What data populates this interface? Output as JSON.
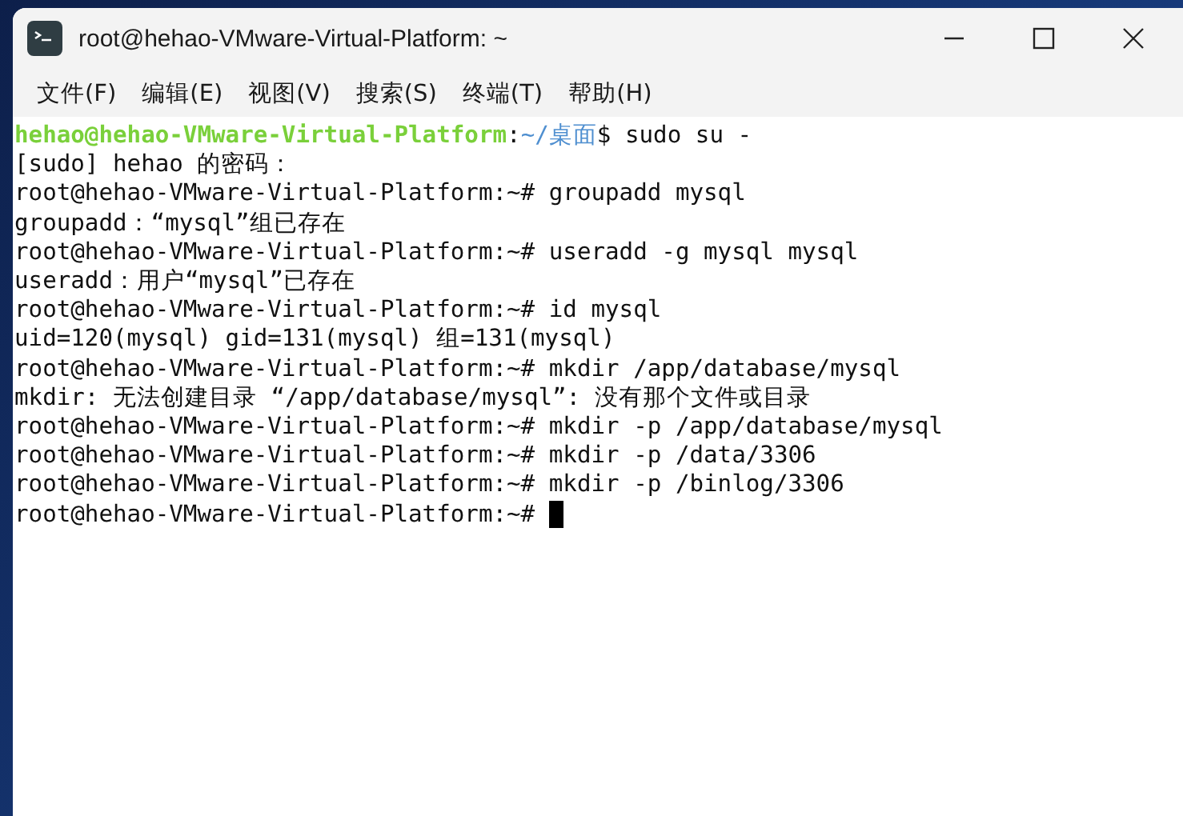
{
  "window": {
    "title": "root@hehao-VMware-Virtual-Platform: ~"
  },
  "menu": [
    "文件(F)",
    "编辑(E)",
    "视图(V)",
    "搜索(S)",
    "终端(T)",
    "帮助(H)"
  ],
  "terminal": {
    "lines": [
      {
        "segments": [
          {
            "kind": "user",
            "text": "hehao@hehao-VMware-Virtual-Platform"
          },
          {
            "kind": "plain",
            "text": ":"
          },
          {
            "kind": "path",
            "text": "~/桌面"
          },
          {
            "kind": "plain",
            "text": "$ sudo su -"
          }
        ]
      },
      {
        "segments": [
          {
            "kind": "plain",
            "text": "[sudo] hehao 的密码："
          }
        ]
      },
      {
        "segments": [
          {
            "kind": "plain",
            "text": "root@hehao-VMware-Virtual-Platform:~# groupadd mysql"
          }
        ]
      },
      {
        "segments": [
          {
            "kind": "plain",
            "text": "groupadd：“mysql”组已存在"
          }
        ]
      },
      {
        "segments": [
          {
            "kind": "plain",
            "text": "root@hehao-VMware-Virtual-Platform:~# useradd -g mysql mysql"
          }
        ]
      },
      {
        "segments": [
          {
            "kind": "plain",
            "text": "useradd：用户“mysql”已存在"
          }
        ]
      },
      {
        "segments": [
          {
            "kind": "plain",
            "text": "root@hehao-VMware-Virtual-Platform:~# id mysql"
          }
        ]
      },
      {
        "segments": [
          {
            "kind": "plain",
            "text": "uid=120(mysql) gid=131(mysql) 组=131(mysql)"
          }
        ]
      },
      {
        "segments": [
          {
            "kind": "plain",
            "text": "root@hehao-VMware-Virtual-Platform:~# mkdir /app/database/mysql"
          }
        ]
      },
      {
        "segments": [
          {
            "kind": "plain",
            "text": "mkdir: 无法创建目录 “/app/database/mysql”: 没有那个文件或目录"
          }
        ]
      },
      {
        "segments": [
          {
            "kind": "plain",
            "text": "root@hehao-VMware-Virtual-Platform:~# mkdir -p /app/database/mysql"
          }
        ]
      },
      {
        "segments": [
          {
            "kind": "plain",
            "text": "root@hehao-VMware-Virtual-Platform:~# mkdir -p /data/3306"
          }
        ]
      },
      {
        "segments": [
          {
            "kind": "plain",
            "text": "root@hehao-VMware-Virtual-Platform:~# mkdir -p /binlog/3306"
          }
        ]
      }
    ],
    "prompt": "root@hehao-VMware-Virtual-Platform:~#"
  }
}
